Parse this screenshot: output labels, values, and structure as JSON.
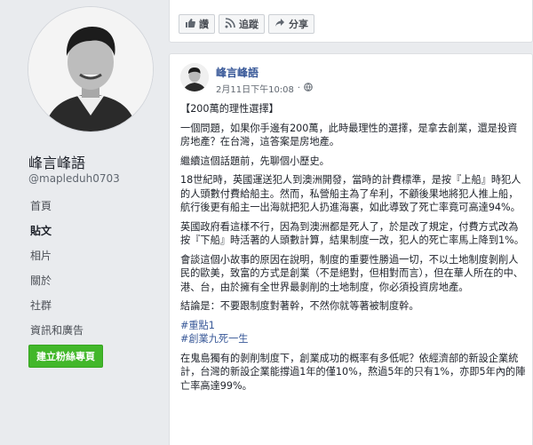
{
  "sidebar": {
    "page_name": "峰言峰語",
    "handle": "@mapleduh0703",
    "nav": [
      {
        "label": "首頁",
        "active": false
      },
      {
        "label": "貼文",
        "active": true
      },
      {
        "label": "相片",
        "active": false
      },
      {
        "label": "關於",
        "active": false
      },
      {
        "label": "社群",
        "active": false
      },
      {
        "label": "資訊和廣告",
        "active": false
      }
    ],
    "create_button": "建立粉絲專頁"
  },
  "toolbar": {
    "like_label": "讚",
    "follow_label": "追蹤",
    "share_label": "分享"
  },
  "post": {
    "author": "峰言峰語",
    "time": "2月11日下午10:08",
    "paragraphs": [
      "【200萬的理性選擇】",
      "一個問題，如果你手邊有200萬，此時最理性的選擇，是拿去創業，還是投資房地產？在台灣，這答案是房地產。",
      "繼續這個話題前，先聊個小歷史。",
      "18世紀時，英國運送犯人到澳洲開發，當時的計費標準，是按『上船』時犯人的人頭數付費給船主。然而，私營船主為了牟利，不顧後果地將犯人推上船，航行後更有船主一出海就把犯人扔進海裏，如此導致了死亡率竟可高達94%。",
      "英國政府看這樣不行，因為到澳洲都是死人了，於是改了規定，付費方式改為按『下船』時活著的人頭數計算，結果制度一改，犯人的死亡率馬上降到1%。",
      "會談這個小故事的原因在說明，制度的重要性勝過一切，不以土地制度剝削人民的歐美，致富的方式是創業（不是絕對，但相對而言），但在華人所在的中、港、台，由於擁有全世界最剝削的土地制度，你必須投資房地產。",
      "結論是：不要跟制度對著幹，不然你就等著被制度幹。"
    ],
    "tags": [
      "#重點1",
      "#創業九死一生"
    ],
    "last_paragraph": "在鬼島獨有的剝削制度下，創業成功的概率有多低呢？依經濟部的新設企業統計，台灣的新設企業能撐過1年的僅10%，熬過5年的只有1%，亦即5年內的陣亡率高達99%。"
  },
  "colors": {
    "link": "#385898",
    "create_button_bg": "#42b72a",
    "page_bg": "#e9ebee"
  }
}
